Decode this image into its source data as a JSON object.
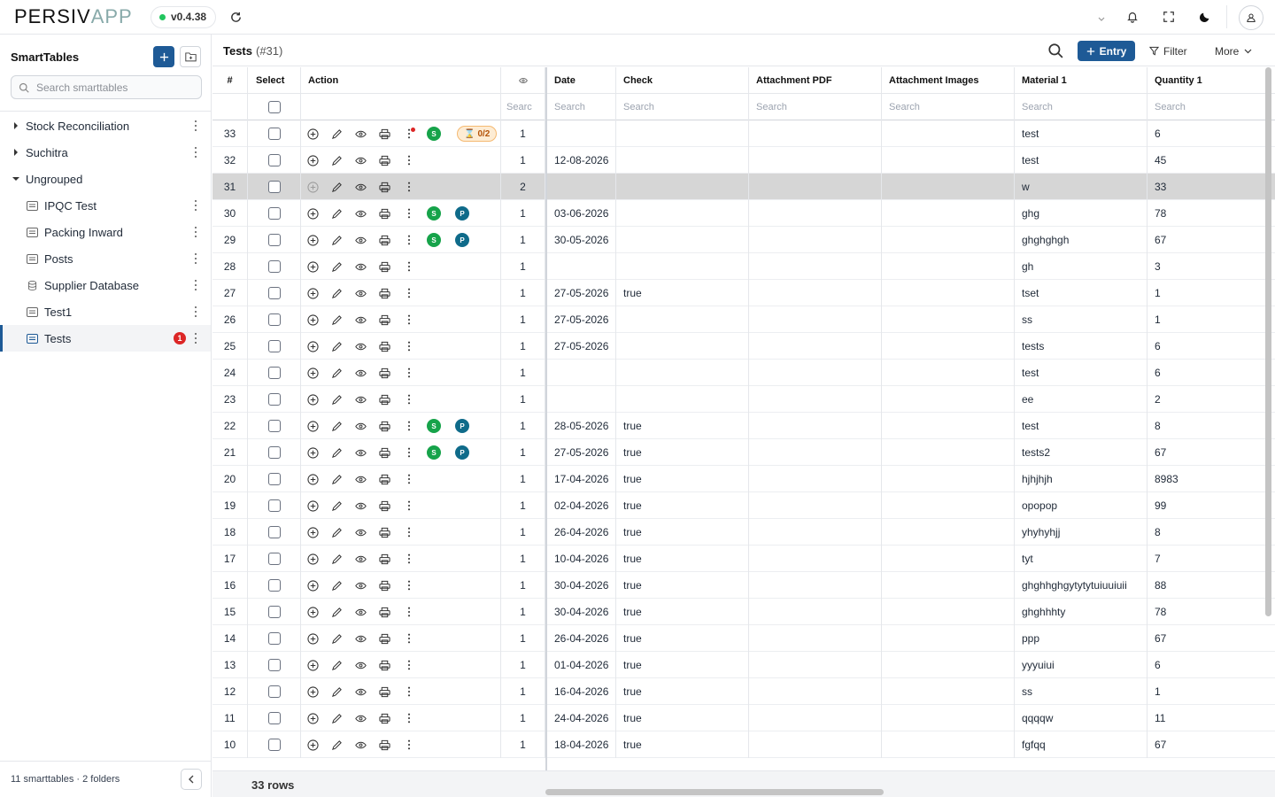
{
  "app": {
    "logo_left": "PERSIV",
    "logo_right": "APP",
    "version": "v0.4.38"
  },
  "sidebar": {
    "title": "SmartTables",
    "search_placeholder": "Search smarttables",
    "groups": [
      {
        "label": "Stock Reconciliation",
        "expanded": false
      },
      {
        "label": "Suchitra",
        "expanded": false
      },
      {
        "label": "Ungrouped",
        "expanded": true
      }
    ],
    "items": [
      {
        "label": "IPQC Test",
        "icon": "table-icon"
      },
      {
        "label": "Packing Inward",
        "icon": "table-icon"
      },
      {
        "label": "Posts",
        "icon": "table-icon"
      },
      {
        "label": "Supplier Database",
        "icon": "database-icon"
      },
      {
        "label": "Test1",
        "icon": "table-icon"
      },
      {
        "label": "Tests",
        "icon": "table-icon",
        "active": true,
        "badge": "1"
      }
    ],
    "footer": "11 smarttables · 2 folders"
  },
  "main": {
    "title": "Tests",
    "subtitle": "(#31)",
    "entry_label": "Entry",
    "filter_label": "Filter",
    "more_label": "More"
  },
  "table": {
    "columns": [
      "#",
      "Select",
      "Action",
      "",
      "Date",
      "Check",
      "Attachment PDF",
      "Attachment Images",
      "Material 1",
      "Quantity 1"
    ],
    "search_placeholder": "Search",
    "search_placeholder_short": "Searc",
    "rows": [
      {
        "id": "33",
        "v": "1",
        "date": "",
        "check": "",
        "mat": "test",
        "qty": "6",
        "s": true,
        "p": false,
        "hg": "0/2",
        "dot": true
      },
      {
        "id": "32",
        "v": "1",
        "date": "12-08-2026",
        "check": "",
        "mat": "test",
        "qty": "45"
      },
      {
        "id": "31",
        "v": "2",
        "date": "",
        "check": "",
        "mat": "w",
        "qty": "33",
        "hl": true
      },
      {
        "id": "30",
        "v": "1",
        "date": "03-06-2026",
        "check": "",
        "mat": "ghg",
        "qty": "78",
        "s": true,
        "p": true
      },
      {
        "id": "29",
        "v": "1",
        "date": "30-05-2026",
        "check": "",
        "mat": "ghghghgh",
        "qty": "67",
        "s": true,
        "p": true
      },
      {
        "id": "28",
        "v": "1",
        "date": "",
        "check": "",
        "mat": "gh",
        "qty": "3"
      },
      {
        "id": "27",
        "v": "1",
        "date": "27-05-2026",
        "check": "true",
        "mat": "tset",
        "qty": "1"
      },
      {
        "id": "26",
        "v": "1",
        "date": "27-05-2026",
        "check": "",
        "mat": "ss",
        "qty": "1"
      },
      {
        "id": "25",
        "v": "1",
        "date": "27-05-2026",
        "check": "",
        "mat": "tests",
        "qty": "6"
      },
      {
        "id": "24",
        "v": "1",
        "date": "",
        "check": "",
        "mat": "test",
        "qty": "6"
      },
      {
        "id": "23",
        "v": "1",
        "date": "",
        "check": "",
        "mat": "ee",
        "qty": "2"
      },
      {
        "id": "22",
        "v": "1",
        "date": "28-05-2026",
        "check": "true",
        "mat": "test",
        "qty": "8",
        "s": true,
        "p": true
      },
      {
        "id": "21",
        "v": "1",
        "date": "27-05-2026",
        "check": "true",
        "mat": "tests2",
        "qty": "67",
        "s": true,
        "p": true
      },
      {
        "id": "20",
        "v": "1",
        "date": "17-04-2026",
        "check": "true",
        "mat": "hjhjhjh",
        "qty": "8983"
      },
      {
        "id": "19",
        "v": "1",
        "date": "02-04-2026",
        "check": "true",
        "mat": "opopop",
        "qty": "99"
      },
      {
        "id": "18",
        "v": "1",
        "date": "26-04-2026",
        "check": "true",
        "mat": "yhyhyhjj",
        "qty": "8"
      },
      {
        "id": "17",
        "v": "1",
        "date": "10-04-2026",
        "check": "true",
        "mat": "tyt",
        "qty": "7"
      },
      {
        "id": "16",
        "v": "1",
        "date": "30-04-2026",
        "check": "true",
        "mat": "ghghhghgytytytuiuuiuii",
        "qty": "88"
      },
      {
        "id": "15",
        "v": "1",
        "date": "30-04-2026",
        "check": "true",
        "mat": "ghghhhty",
        "qty": "78"
      },
      {
        "id": "14",
        "v": "1",
        "date": "26-04-2026",
        "check": "true",
        "mat": "ppp",
        "qty": "67"
      },
      {
        "id": "13",
        "v": "1",
        "date": "01-04-2026",
        "check": "true",
        "mat": "yyyuiui",
        "qty": "6"
      },
      {
        "id": "12",
        "v": "1",
        "date": "16-04-2026",
        "check": "true",
        "mat": "ss",
        "qty": "1"
      },
      {
        "id": "11",
        "v": "1",
        "date": "24-04-2026",
        "check": "true",
        "mat": "qqqqw",
        "qty": "11"
      },
      {
        "id": "10",
        "v": "1",
        "date": "18-04-2026",
        "check": "true",
        "mat": "fgfqq",
        "qty": "67"
      }
    ],
    "row_count": "33 rows"
  }
}
